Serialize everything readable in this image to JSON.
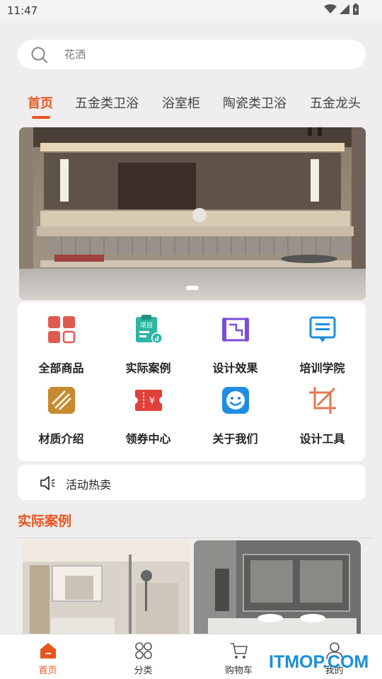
{
  "status": {
    "time": "11:47"
  },
  "search": {
    "placeholder": "花洒"
  },
  "tabs": [
    "首页",
    "五金类卫浴",
    "浴室柜",
    "陶瓷类卫浴",
    "五金龙头"
  ],
  "grid": [
    {
      "label": "全部商品",
      "icon": "all-products-icon"
    },
    {
      "label": "实际案例",
      "icon": "cases-icon",
      "badge": "项目"
    },
    {
      "label": "设计效果",
      "icon": "design-effect-icon"
    },
    {
      "label": "培训学院",
      "icon": "training-icon"
    },
    {
      "label": "材质介绍",
      "icon": "material-icon"
    },
    {
      "label": "领券中心",
      "icon": "coupon-icon",
      "badge": "¥"
    },
    {
      "label": "关于我们",
      "icon": "about-us-icon"
    },
    {
      "label": "设计工具",
      "icon": "design-tool-icon"
    }
  ],
  "notice": {
    "text": "活动热卖"
  },
  "section": {
    "title": "实际案例"
  },
  "nav": [
    "首页",
    "分类",
    "购物车",
    "我的"
  ],
  "watermark": "ITMOP.COM",
  "colors": {
    "accent": "#e8551e",
    "background": "#efeded"
  }
}
